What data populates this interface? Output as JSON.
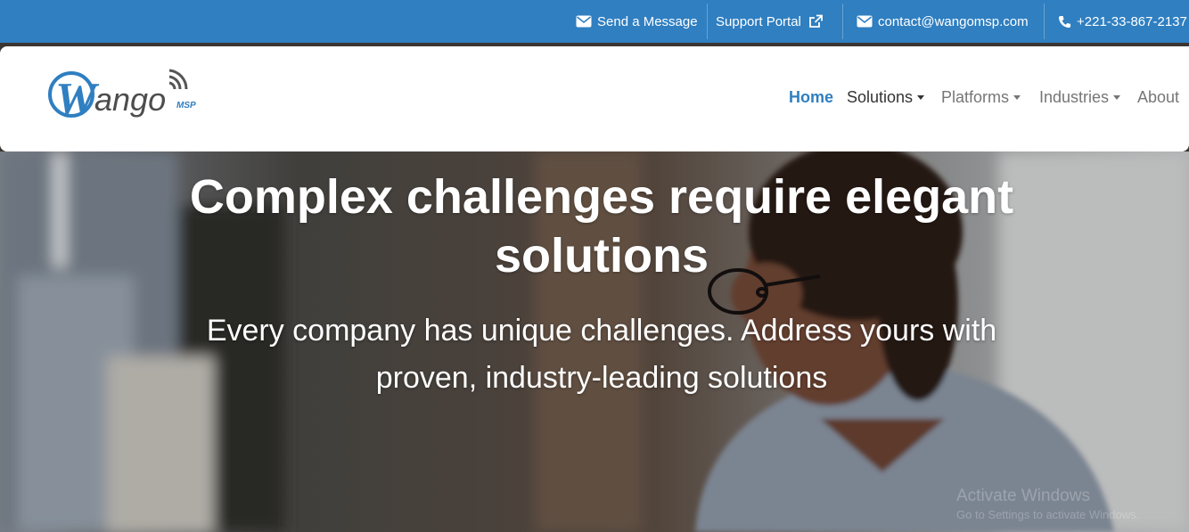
{
  "topbar": {
    "bg_color": "#2f7fc1",
    "send_message": {
      "label": "Send a Message",
      "icon": "envelope-icon"
    },
    "support_portal": {
      "label": "Support Portal",
      "icon": "external-link-icon"
    },
    "email": {
      "label": "contact@wangomsp.com",
      "icon": "envelope-icon"
    },
    "phone": {
      "label": "+221-33-867-2137",
      "icon": "phone-icon"
    }
  },
  "logo": {
    "text": "Wango",
    "tag": "MSP"
  },
  "nav": {
    "accent_color": "#2f7fc1",
    "items": [
      {
        "label": "Home",
        "active": true
      },
      {
        "label": "Solutions",
        "dropdown": true
      },
      {
        "label": "Platforms",
        "dropdown": true
      },
      {
        "label": "Industries",
        "dropdown": true
      },
      {
        "label": "About"
      }
    ]
  },
  "hero": {
    "title_line1": "Complex challenges require elegant",
    "title_line2": "solutions",
    "subtitle_line1": "Every company has unique challenges. Address yours with",
    "subtitle_line2": "proven, industry-leading solutions"
  },
  "watermark": {
    "title": "Activate Windows",
    "subtitle": "Go to Settings to activate Windows."
  }
}
